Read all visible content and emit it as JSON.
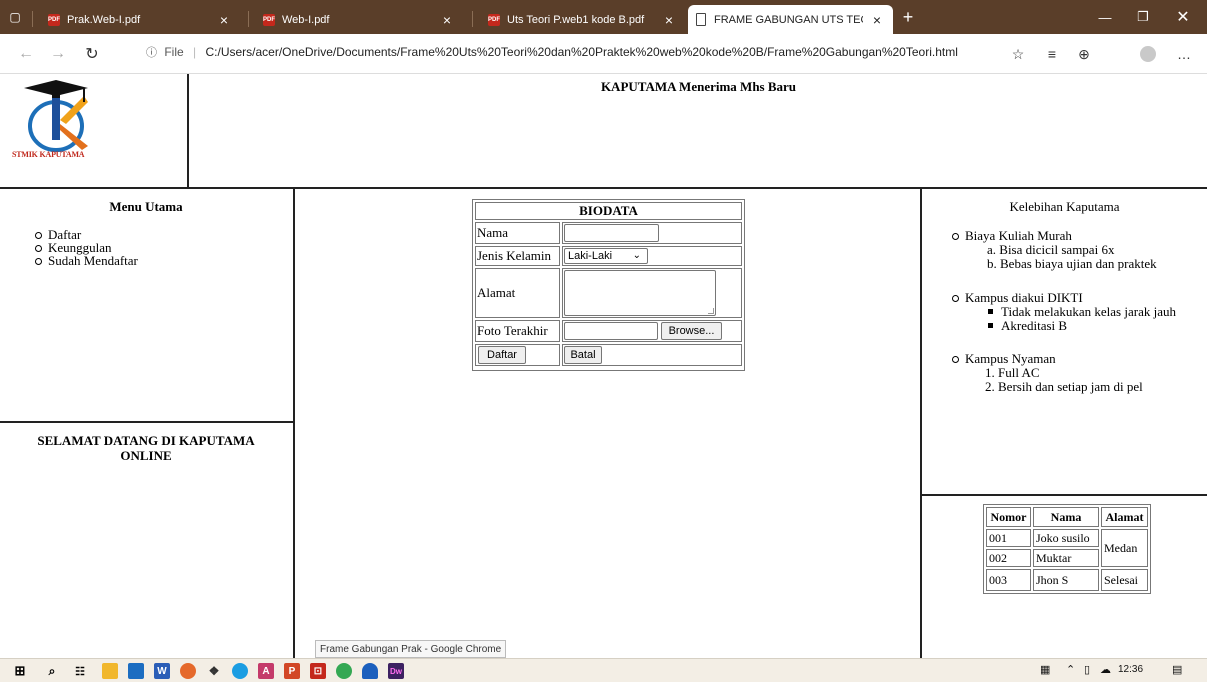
{
  "browser": {
    "tabs": [
      {
        "title": "Prak.Web-I.pdf",
        "icon": "pdf-icon",
        "active": false
      },
      {
        "title": "Web-I.pdf",
        "icon": "pdf-icon",
        "active": false
      },
      {
        "title": "Uts Teori P.web1 kode B.pdf",
        "icon": "pdf-icon",
        "active": false
      },
      {
        "title": "FRAME GABUNGAN UTS TEORI D",
        "icon": "page-icon",
        "active": true
      }
    ],
    "file_label": "File",
    "url": "C:/Users/acer/OneDrive/Documents/Frame%20Uts%20Teori%20dan%20Praktek%20web%20kode%20B/Frame%20Gabungan%20Teori.html",
    "accent": "#5a3e29"
  },
  "header": {
    "logo_text": "STMIK KAPUTAMA",
    "title": "KAPUTAMA Menerima Mhs Baru"
  },
  "menu": {
    "title": "Menu Utama",
    "items": [
      "Daftar",
      "Keunggulan",
      "Sudah Mendaftar"
    ]
  },
  "welcome": "SELAMAT DATANG DI KAPUTAMA ONLINE",
  "form": {
    "title": "BIODATA",
    "nama_label": "Nama",
    "gender_label": "Jenis Kelamin",
    "gender_value": "Laki-Laki",
    "alamat_label": "Alamat",
    "foto_label": "Foto Terakhir",
    "browse_label": "Browse...",
    "submit_label": "Daftar",
    "cancel_label": "Batal"
  },
  "kelebihan": {
    "title": "Kelebihan Kaputama",
    "groups": [
      {
        "heading": "Biaya Kuliah Murah",
        "items": [
          "a. Bisa dicicil sampai 6x",
          "b. Bebas biaya ujian dan praktek"
        ]
      },
      {
        "heading": "Kampus diakui DIKTI",
        "items": [
          "Tidak melakukan kelas jarak jauh",
          "Akreditasi B"
        ]
      },
      {
        "heading": "Kampus Nyaman",
        "items": [
          "1. Full AC",
          "2. Bersih dan setiap jam di pel"
        ]
      }
    ]
  },
  "table": {
    "headers": [
      "Nomor",
      "Nama",
      "Alamat"
    ],
    "rows": [
      {
        "nomor": "001",
        "nama": "Joko susilo"
      },
      {
        "nomor": "002",
        "nama": "Muktar"
      },
      {
        "nomor": "003",
        "nama": "Jhon S",
        "alamat": "Selesai"
      }
    ],
    "merged_alamat": "Medan"
  },
  "status_text": "Frame Gabungan Prak - Google Chrome",
  "taskbar": {
    "time": "12:36"
  }
}
